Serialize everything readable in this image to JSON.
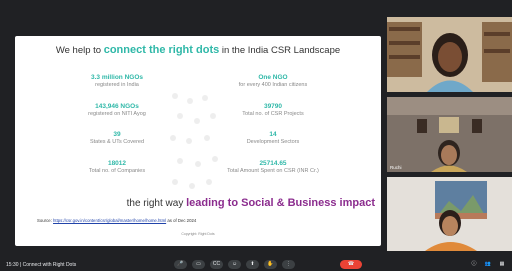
{
  "slide": {
    "title_prefix": "We help to ",
    "title_highlight": "connect the right dots",
    "title_suffix": " in the India CSR Landscape",
    "stats": [
      {
        "value": "3.3 million NGOs",
        "label": "registered in India"
      },
      {
        "value": "One NGO",
        "label": "for every 400 Indian citizens"
      },
      {
        "value": "143,946 NGOs",
        "label": "registered on NITI Ayog"
      },
      {
        "value": "39790",
        "label": "Total no. of CSR Projects"
      },
      {
        "value": "39",
        "label": "States & UTs Covered"
      },
      {
        "value": "14",
        "label": "Development Sectors"
      },
      {
        "value": "18012",
        "label": "Total no. of Companies"
      },
      {
        "value": "25714.65",
        "label": "Total Amount Spent on CSR (INR Cr.)"
      }
    ],
    "tagline_prefix": "the right way ",
    "tagline_highlight": "leading to Social & Business impact",
    "source_label": "Source: ",
    "source_link": "https://csr.gov.in/content/csr/global/master/home/home.html",
    "source_suffix": " as of Dec 2024",
    "copyright": "Copyright: Right Dots"
  },
  "participants": [
    {
      "name": ""
    },
    {
      "name": "Ruchi"
    },
    {
      "name": ""
    }
  ],
  "bottombar": {
    "time_text": "15:30 | Connect with Right Dots",
    "controls": [
      {
        "icon": "mic-icon",
        "glyph": "🎤"
      },
      {
        "icon": "camera-icon",
        "glyph": "▭"
      },
      {
        "icon": "captions-icon",
        "glyph": "CC"
      },
      {
        "icon": "emoji-icon",
        "glyph": "☺"
      },
      {
        "icon": "present-icon",
        "glyph": "⬆"
      },
      {
        "icon": "raise-hand-icon",
        "glyph": "✋"
      },
      {
        "icon": "more-icon",
        "glyph": "⋮"
      }
    ],
    "end_call_glyph": "☎",
    "right_icons": [
      {
        "icon": "info-icon",
        "glyph": "ⓘ"
      },
      {
        "icon": "people-icon",
        "glyph": "👥"
      },
      {
        "icon": "activities-icon",
        "glyph": "▦"
      }
    ]
  },
  "colors": {
    "accent": "#2fb8a8",
    "impact": "#8b2c8e",
    "end_call": "#ea4335"
  }
}
